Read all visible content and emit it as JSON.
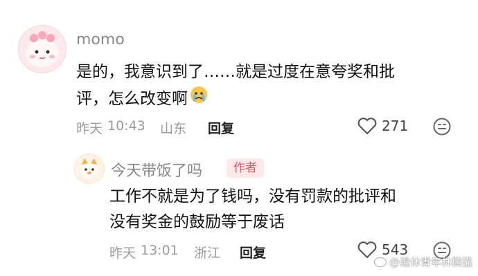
{
  "comment1": {
    "author": "momo",
    "text_line1": "是的，我意识到了……就是过度在意夸奖和批",
    "text_line2": "评，怎么改变啊",
    "emoji": "crying-face-emoji",
    "date": "昨天",
    "time": "10:43",
    "location": "山东",
    "reply_label": "回复",
    "like_count": "271"
  },
  "comment2": {
    "author": "今天带饭了吗",
    "badge": "作者",
    "text_line1": "工作不就是为了钱吗，没有罚款的批评和",
    "text_line2": "没有奖金的鼓励等于废话",
    "date": "昨天",
    "time": "13:01",
    "location": "浙江",
    "reply_label": "回复",
    "like_count": "543"
  },
  "watermark": {
    "text": "@退休青年林熊猫"
  },
  "colors": {
    "badge_bg": "#fde9ea",
    "badge_text": "#e25563",
    "meta_text": "#9b9b9b"
  }
}
